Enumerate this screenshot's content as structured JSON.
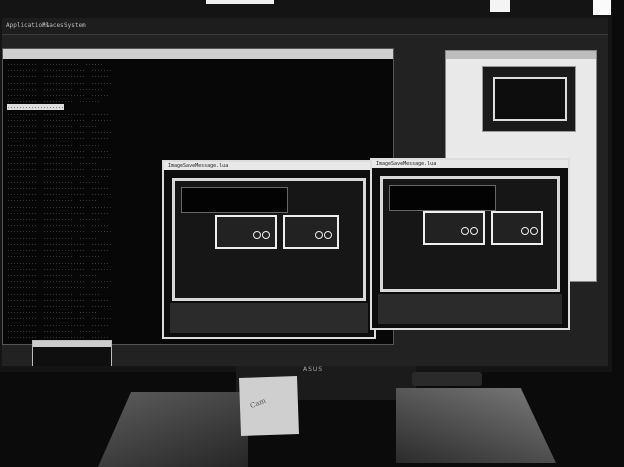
{
  "scene": {
    "description_text": "",
    "top_panel": [
      "Applications",
      "Places",
      "System"
    ],
    "terminal_title": "",
    "camera_window_title": "ImageSaveMessage.lua",
    "camera_window_title2": "ImageSaveMessage.lua",
    "monitor_brand": "ASUS",
    "sticky_note_text": "Cam",
    "taskbar_items": [
      "",
      "",
      "",
      "",
      "",
      ""
    ]
  }
}
